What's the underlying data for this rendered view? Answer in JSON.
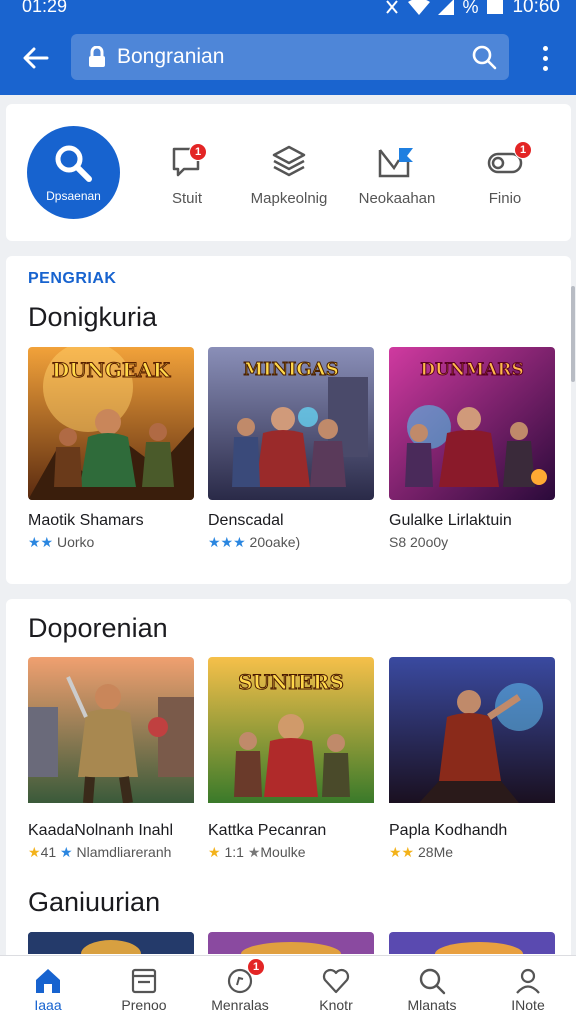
{
  "status_bar": {
    "time": "01:29",
    "clock": "10:60",
    "battery_text": "%"
  },
  "app_bar": {
    "search_value": "Bongranian",
    "search_placeholder": "Bongranian"
  },
  "quick_actions": [
    {
      "label": "Dpsaenan",
      "icon": "search-icon"
    },
    {
      "label": "Stuit",
      "icon": "chat-icon",
      "badge": "1"
    },
    {
      "label": "Mapkeolnig",
      "icon": "layers-icon"
    },
    {
      "label": "Neokaahan",
      "icon": "map-flag-icon"
    },
    {
      "label": "Finio",
      "icon": "toggle-icon",
      "badge": "1"
    }
  ],
  "section1": {
    "tag": "PENGRIAK",
    "title": "Donigkuria",
    "games": [
      {
        "name": "Maotik Shamars",
        "stars": "★★",
        "meta": "Uorko",
        "art": "DUNGEAK",
        "star_color": "#2a86e0"
      },
      {
        "name": "Denscadal",
        "stars": "★★★",
        "meta": "20oake)",
        "art": "MINIGAS",
        "star_color": "#2a86e0"
      },
      {
        "name": "Gulalke Lirlaktuin",
        "stars": "",
        "meta": "S8 20o0y",
        "art": "DUNMARS",
        "star_color": "#777777"
      }
    ]
  },
  "section2": {
    "title": "Doporenian",
    "games": [
      {
        "name": "KaadaNolnanh Inahl",
        "stars": "★",
        "meta": "41",
        "stars2": "★",
        "meta2": "Nlamdliareranh",
        "art": ""
      },
      {
        "name": "Kattka Pecanran",
        "stars": "★",
        "meta": "1:1",
        "stars2": "★",
        "meta2": "Moulke",
        "art": "SUNIERS"
      },
      {
        "name": "Papla Kodhandh",
        "stars": "★★",
        "meta": "28Me",
        "art": ""
      }
    ]
  },
  "section3": {
    "title": "Ganiuurian"
  },
  "bottom_nav": [
    {
      "label": "Iaaa",
      "icon": "home-icon",
      "active": true
    },
    {
      "label": "Prenoo",
      "icon": "calendar-icon"
    },
    {
      "label": "Menralas",
      "icon": "circle-chat-icon",
      "badge": "1"
    },
    {
      "label": "Knotr",
      "icon": "heart-icon"
    },
    {
      "label": "Mlanats",
      "icon": "search-icon"
    },
    {
      "label": "INote",
      "icon": "profile-icon"
    }
  ],
  "colors": {
    "brand": "#1a64cf",
    "accent": "#1763cf",
    "badge": "#e32525",
    "star": "#f3b21a"
  }
}
